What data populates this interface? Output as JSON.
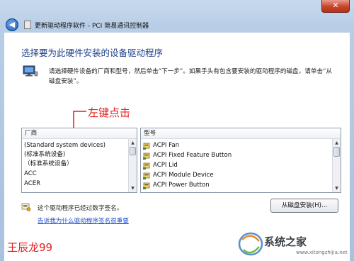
{
  "window": {
    "title": "更新驱动程序软件 - PCI 简易通讯控制器",
    "back_glyph": "◀",
    "close_glyph": "✕"
  },
  "heading": "选择要为此硬件安装的设备驱动程序",
  "instruction": "请选择硬件设备的厂商和型号，然后单击“下一步”。如果手头有包含要安装的驱动程序的磁盘，请单击“从磁盘安装”。",
  "annotation": "左键点击",
  "manufacturer_list": {
    "header": "厂商",
    "items": [
      "(Standard system devices)",
      "(标准系统设备)",
      "（标准系统设备）",
      "ACC",
      "ACER"
    ]
  },
  "model_list": {
    "header": "型号",
    "items": [
      "ACPI Fan",
      "ACPI Fixed Feature Button",
      "ACPI Lid",
      "ACPI Module Device",
      "ACPI Power Button"
    ]
  },
  "signed_text": "这个驱动程序已经过数字签名。",
  "have_disk_button": "从磁盘安装(H)...",
  "why_link": "告诉我为什么驱动程序签名很重要",
  "watermark_left": "王辰龙99",
  "watermark_right": {
    "text": "系统之家",
    "url": "www.xitongzhijia.net"
  }
}
